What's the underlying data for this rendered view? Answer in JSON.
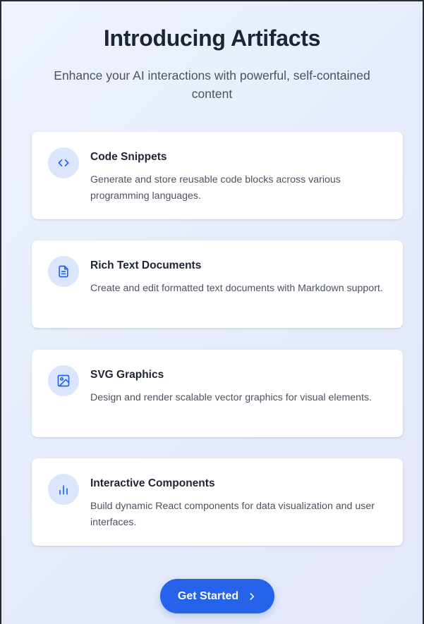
{
  "header": {
    "title": "Introducing Artifacts",
    "subtitle": "Enhance your AI interactions with powerful, self-contained content"
  },
  "features": [
    {
      "title": "Code Snippets",
      "description": "Generate and store reusable code blocks across various programming languages.",
      "icon": "code-icon"
    },
    {
      "title": "Rich Text Documents",
      "description": "Create and edit formatted text documents with Markdown support.",
      "icon": "document-icon"
    },
    {
      "title": "SVG Graphics",
      "description": "Design and render scalable vector graphics for visual elements.",
      "icon": "image-icon"
    },
    {
      "title": "Interactive Components",
      "description": "Build dynamic React components for data visualization and user interfaces.",
      "icon": "bar-chart-icon"
    }
  ],
  "cta": {
    "label": "Get Started",
    "icon": "chevron-right-icon"
  },
  "colors": {
    "accent": "#2563eb",
    "icon_bg": "#dbe6fd",
    "title": "#1e2433",
    "body_text": "#4b5261"
  }
}
